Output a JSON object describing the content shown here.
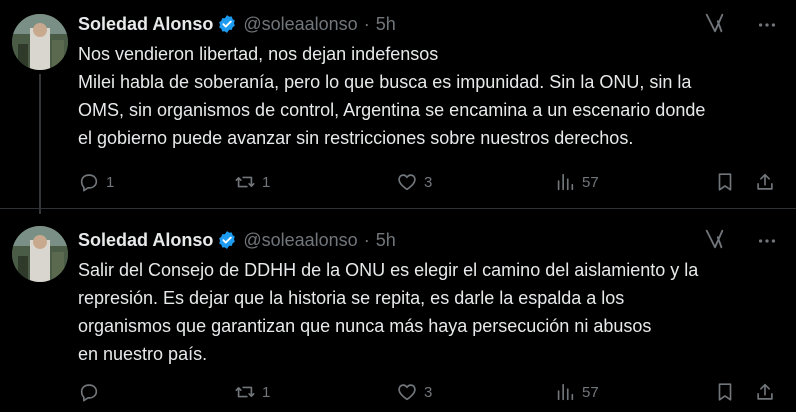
{
  "tweets": [
    {
      "author": {
        "name": "Soledad Alonso",
        "handle": "@soleaalonso",
        "verified": true
      },
      "time": "5h",
      "lines": [
        "Nos vendieron libertad, nos dejan indefensos",
        "Milei habla de soberanía, pero lo que busca es impunidad. Sin la ONU, sin la",
        "OMS, sin organismos de control, Argentina se encamina a un escenario donde",
        "el gobierno puede avanzar sin restricciones sobre nuestros derechos."
      ],
      "stats": {
        "replies": "1",
        "reposts": "1",
        "likes": "3",
        "views": "57"
      }
    },
    {
      "author": {
        "name": "Soledad Alonso",
        "handle": "@soleaalonso",
        "verified": true
      },
      "time": "5h",
      "lines": [
        "Salir del Consejo de DDHH de la ONU es elegir el camino del aislamiento y la",
        "represión. Es dejar que la historia se repita, es darle la espalda a los",
        "organismos que garantizan que nunca más haya persecución ni abusos",
        "en nuestro país."
      ],
      "stats": {
        "replies": "",
        "reposts": "1",
        "likes": "3",
        "views": "57"
      }
    }
  ],
  "icons": {
    "verified": "verified-badge-icon",
    "grok": "grok-icon",
    "more": "more-icon",
    "reply": "reply-icon",
    "repost": "repost-icon",
    "like": "like-icon",
    "views": "views-icon",
    "bookmark": "bookmark-icon",
    "share": "share-icon"
  },
  "colors": {
    "background": "#000000",
    "text": "#e7e9ea",
    "muted": "#71767b",
    "verified": "#1d9bf0"
  }
}
